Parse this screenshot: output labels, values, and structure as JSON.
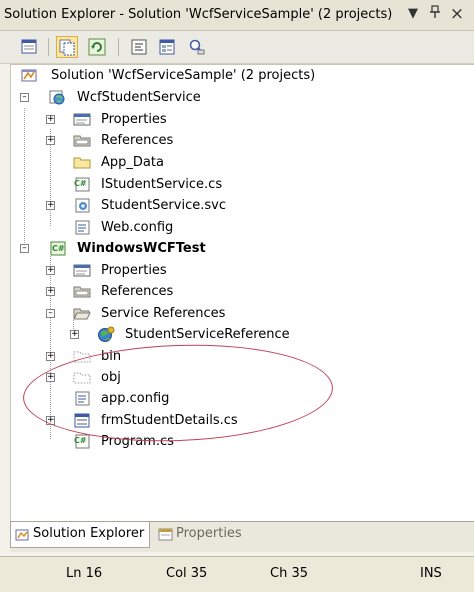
{
  "window": {
    "title": "Solution Explorer - Solution 'WcfServiceSample' (2 projects)",
    "dropdown_glyph": "▼",
    "pin_glyph": "ꟸ",
    "close_glyph": "×"
  },
  "tree": {
    "solution": "Solution 'WcfServiceSample' (2 projects)",
    "project1": {
      "name": "WcfStudentService",
      "items": [
        "Properties",
        "References",
        "App_Data",
        "IStudentService.cs",
        "StudentService.svc",
        "Web.config"
      ]
    },
    "project2": {
      "name": "WindowsWCFTest",
      "items": [
        "Properties",
        "References",
        "Service References",
        "StudentServiceReference",
        "bin",
        "obj",
        "app.config",
        "frmStudentDetails.cs",
        "Program.cs"
      ]
    }
  },
  "tabs": {
    "solution_explorer": "Solution Explorer",
    "properties": "Properties"
  },
  "status": {
    "line": "Ln 16",
    "col": "Col 35",
    "ch": "Ch 35",
    "mode": "INS"
  }
}
